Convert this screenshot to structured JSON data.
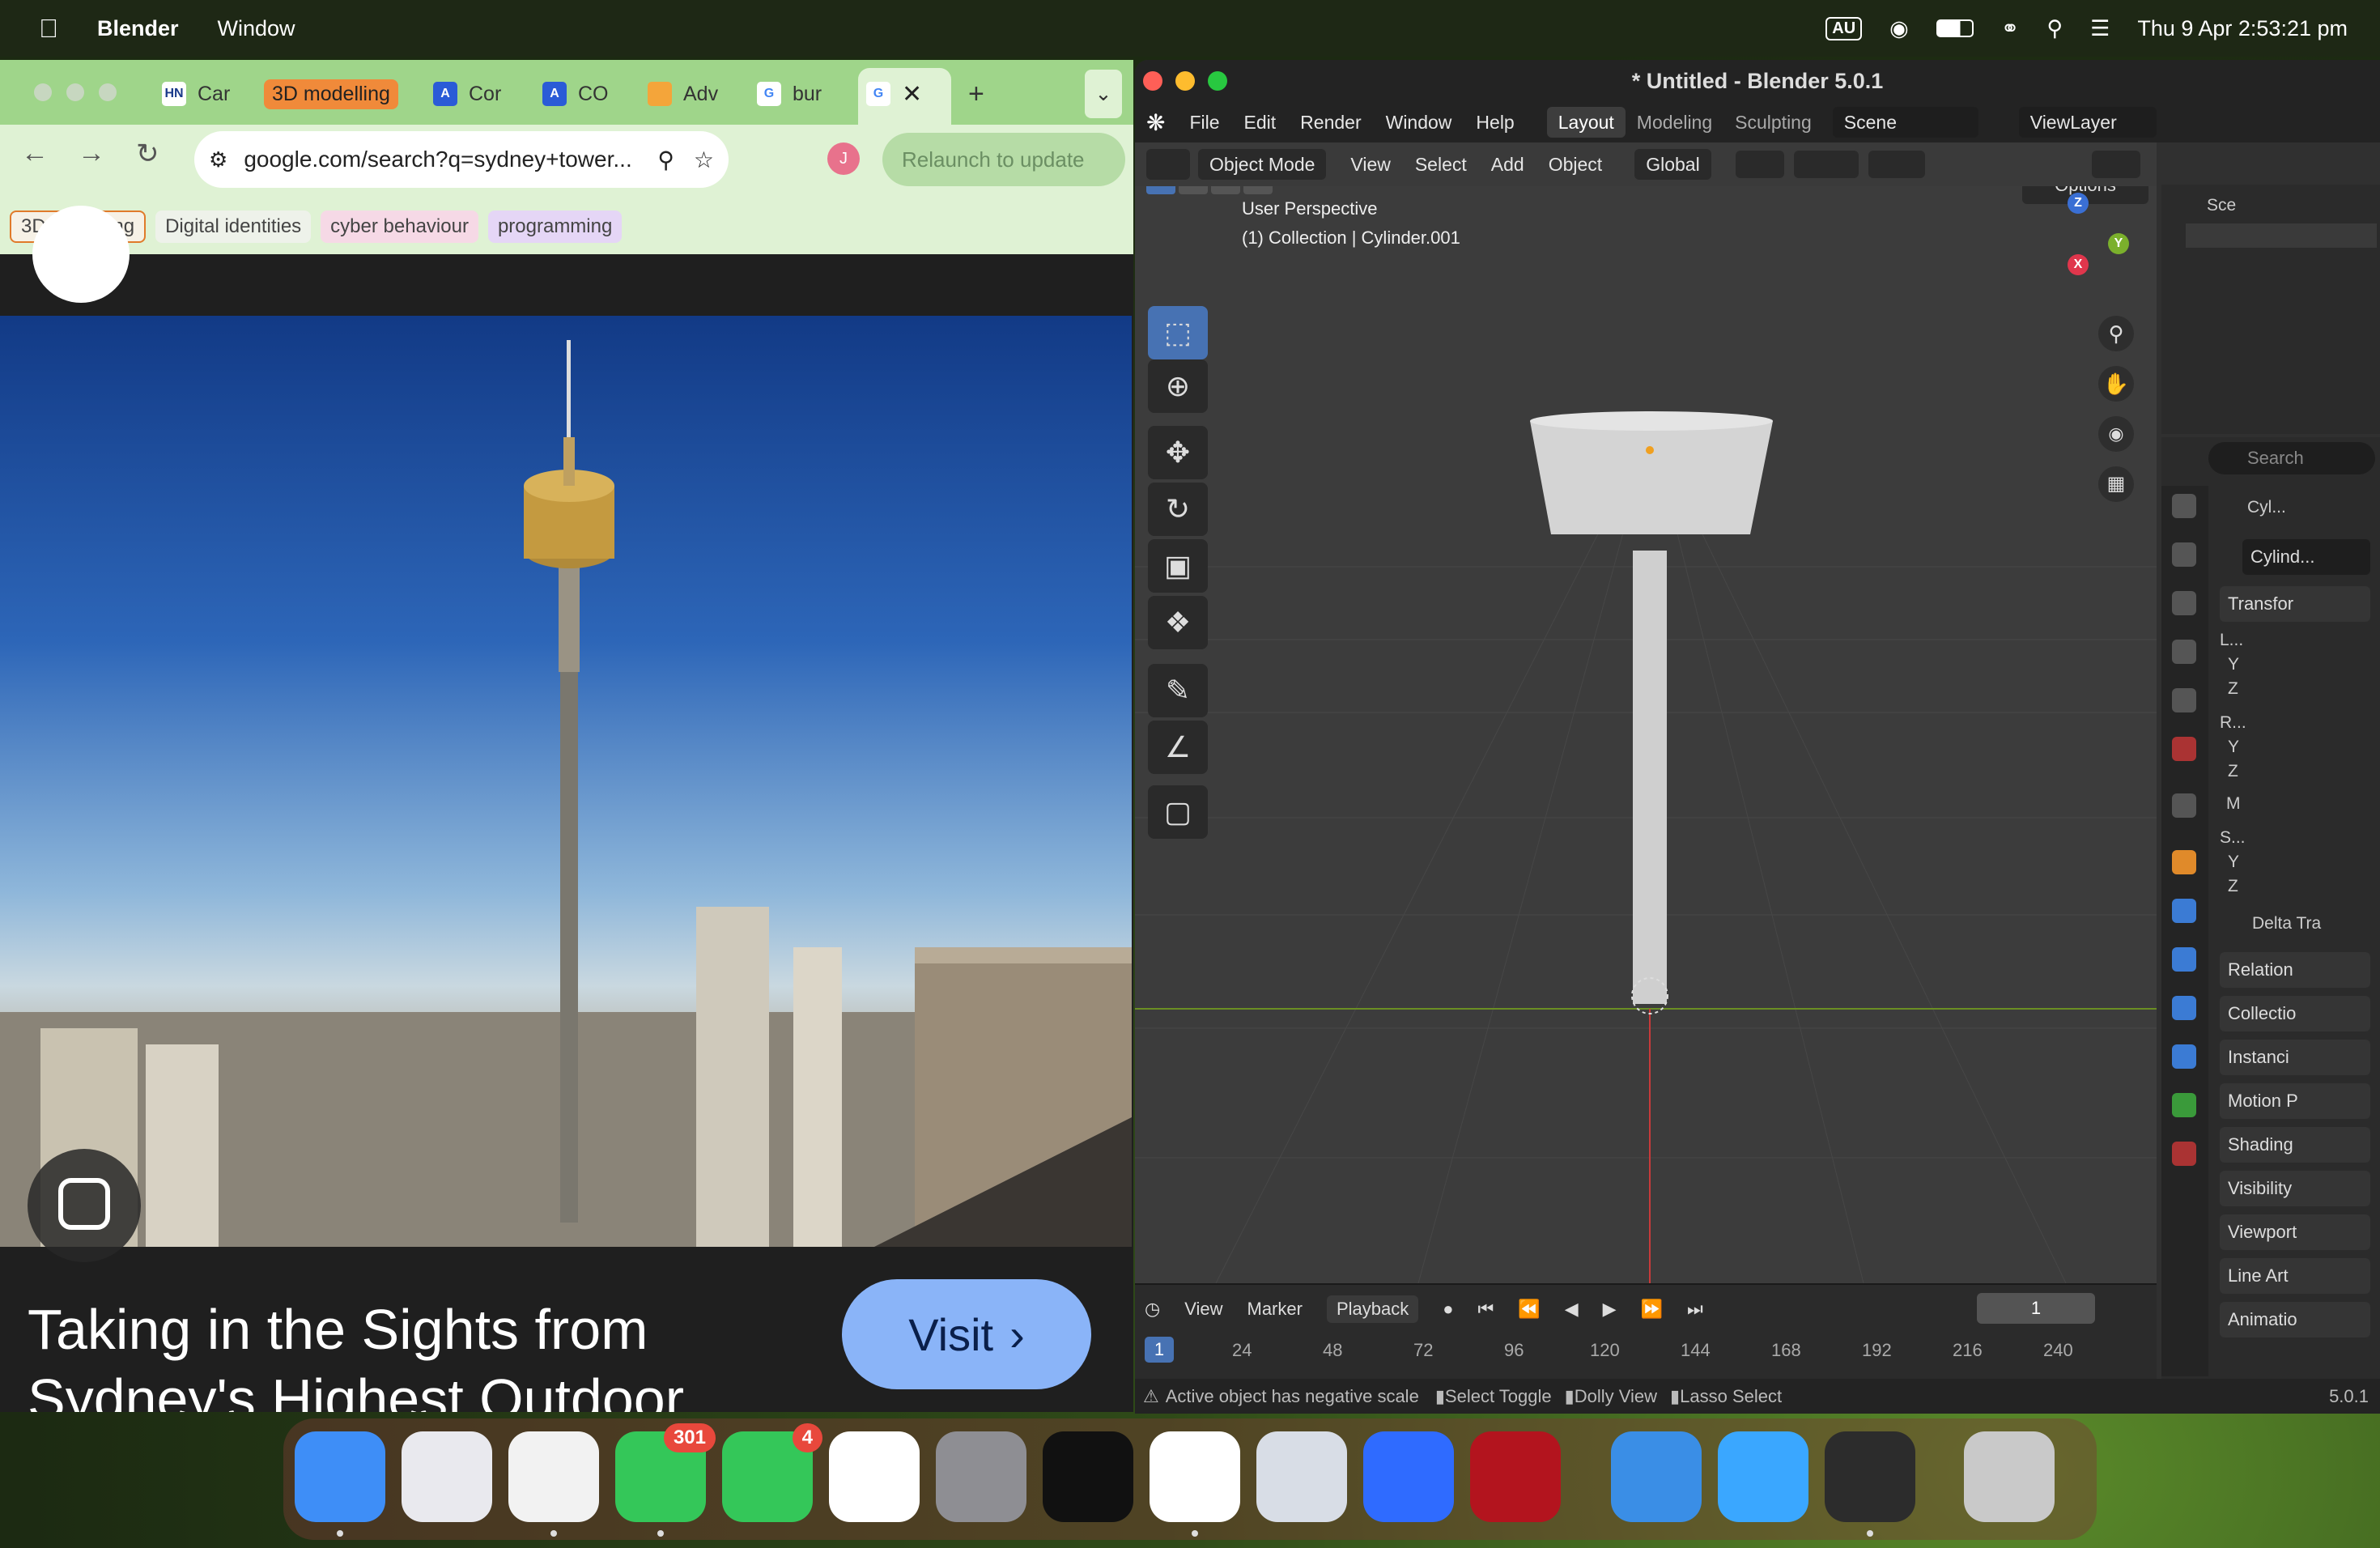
{
  "menubar": {
    "app_name": "Blender",
    "menu_items": [
      "Window"
    ],
    "keyboard_layout": "AU",
    "datetime": "Thu 9 Apr  2:53:21 pm"
  },
  "chrome": {
    "tabs": [
      {
        "label": "Car",
        "favicon": "HN"
      },
      {
        "label": "3D modelling",
        "favicon": ""
      },
      {
        "label": "Cor",
        "favicon": "A"
      },
      {
        "label": "CO",
        "favicon": "A"
      },
      {
        "label": "Adv",
        "favicon": ""
      },
      {
        "label": "bur",
        "favicon": "G"
      },
      {
        "label": "",
        "favicon": "G"
      }
    ],
    "new_tab": "+",
    "url": "google.com/search?q=sydney+tower...",
    "profile_initial": "J",
    "relaunch_label": "Relaunch to update",
    "bookmarks": [
      "3D modelling",
      "Digital identities",
      "cyber behaviour",
      "programming"
    ],
    "page": {
      "caption": "Taking in the Sights from Sydney's Highest Outdoor",
      "visit_label": "Visit"
    }
  },
  "blender": {
    "title": "* Untitled - Blender 5.0.1",
    "menu": [
      "File",
      "Edit",
      "Render",
      "Window",
      "Help"
    ],
    "workspaces": [
      "Layout",
      "Modeling",
      "Sculpting"
    ],
    "active_workspace": "Layout",
    "scene": "Scene",
    "view_layer": "ViewLayer",
    "header": {
      "mode": "Object Mode",
      "menus": [
        "View",
        "Select",
        "Add",
        "Object"
      ],
      "orientation": "Global",
      "options_label": "Options"
    },
    "viewport": {
      "perspective": "User Perspective",
      "collection": "(1) Collection | Cylinder.001",
      "gizmo_axes": [
        "Z",
        "Y",
        "X"
      ]
    },
    "timeline": {
      "menus": [
        "View",
        "Marker",
        "Playback"
      ],
      "current_frame": "1",
      "ticks": [
        "1",
        "24",
        "48",
        "72",
        "96",
        "120",
        "144",
        "168",
        "192",
        "216",
        "240"
      ]
    },
    "status": {
      "warning": "Active object has negative scale",
      "hints": [
        "Select Toggle",
        "Dolly View",
        "Lasso Select"
      ],
      "version": "5.0.1"
    },
    "outliner": {
      "label": "Sce"
    },
    "properties": {
      "search_placeholder": "Search",
      "object_name": "Cyl...",
      "data_name": "Cylind...",
      "transform_label": "Transfor",
      "rows": [
        "L...",
        "Y",
        "Z",
        "R...",
        "Y",
        "Z",
        "M",
        "S...",
        "Y",
        "Z"
      ],
      "delta_label": "Delta Tra",
      "panels": [
        "Relation",
        "Collectio",
        "Instanci",
        "Motion P",
        "Shading",
        "Visibility",
        "Viewport",
        "Line Art",
        "Animatio"
      ]
    }
  },
  "dock": {
    "apps": [
      {
        "name": "finder",
        "color": "#3e8ef7"
      },
      {
        "name": "launchpad",
        "color": "#e9e9ee"
      },
      {
        "name": "chrome",
        "color": "#f2f2f2"
      },
      {
        "name": "messages",
        "color": "#34c759",
        "badge": "301"
      },
      {
        "name": "facetime",
        "color": "#34c759",
        "badge": "4"
      },
      {
        "name": "photos",
        "color": "#ffffff"
      },
      {
        "name": "system-settings",
        "color": "#8e8e93"
      },
      {
        "name": "spotify",
        "color": "#111111"
      },
      {
        "name": "word",
        "color": "#ffffff"
      },
      {
        "name": "preview",
        "color": "#d8dde6"
      },
      {
        "name": "roblox",
        "color": "#2f6bff"
      },
      {
        "name": "wps",
        "color": "#b3141e"
      },
      {
        "name": "keynote",
        "color": "#3a8ee6"
      },
      {
        "name": "lemon",
        "color": "#3aa7ff"
      },
      {
        "name": "blender",
        "color": "#2c2c2c"
      },
      {
        "name": "trash",
        "color": "#c9c9c9"
      }
    ]
  }
}
